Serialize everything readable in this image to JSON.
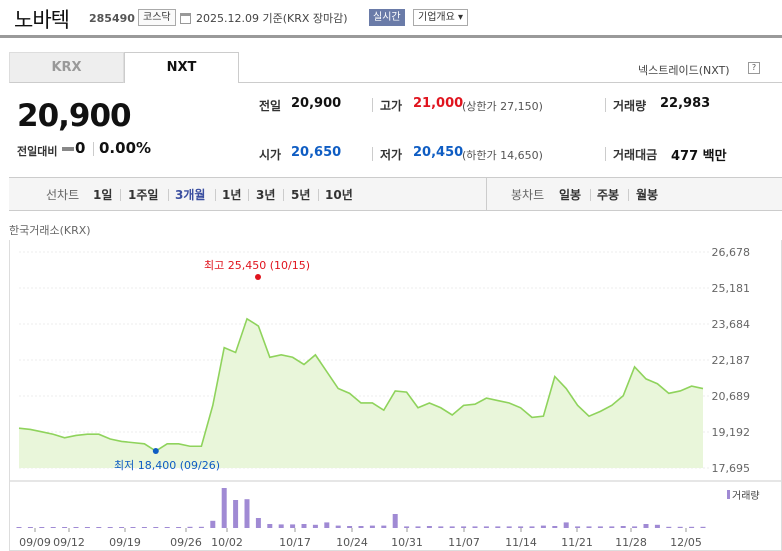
{
  "header": {
    "name": "노바텍",
    "code": "285490",
    "market": "코스닥",
    "as_of": "2025.12.09 기준(KRX 장마감)",
    "realtime": "실시간",
    "company_info": "기업개요 ▾"
  },
  "tabs": [
    {
      "label": "KRX",
      "active": false
    },
    {
      "label": "NXT",
      "active": true
    }
  ],
  "nxt_link": "넥스트레이드(NXT)",
  "nxt_link_icon": "?",
  "quote": {
    "price": "20,900",
    "change_label": "전일대비",
    "change_value": "0",
    "change_pct": "0.00%",
    "prev_close_label": "전일",
    "prev_close": "20,900",
    "high_label": "고가",
    "high": "21,000",
    "upper_limit": "(상한가 27,150)",
    "volume_label": "거래량",
    "volume": "22,983",
    "open_label": "시가",
    "open": "20,650",
    "low_label": "저가",
    "low": "20,450",
    "lower_limit": "(하한가 14,650)",
    "trade_value_label": "거래대금",
    "trade_value": "477 백만"
  },
  "periods": {
    "line_label": "선차트",
    "line_items": [
      "1일",
      "1주일",
      "3개월",
      "1년",
      "3년",
      "5년",
      "10년"
    ],
    "active": "3개월",
    "candle_label": "봉차트",
    "candle_items": [
      "일봉",
      "주봉",
      "월봉"
    ]
  },
  "exchange_label": "한국거래소(KRX)",
  "colors": {
    "accent": "#3b4fa0",
    "up": "#e0141e",
    "down": "#0f5dc3",
    "line": "#8fd35c",
    "fill": "#e9f6da",
    "volume": "#a08ad4"
  },
  "chart_data": {
    "type": "area",
    "ylim": [
      17695,
      26678
    ],
    "yticks": [
      "26,678",
      "25,181",
      "23,684",
      "22,187",
      "20,689",
      "19,192",
      "17,695"
    ],
    "xticks": [
      "09/09",
      "09/12",
      "09/19",
      "09/26",
      "10/02",
      "10/17",
      "10/24",
      "10/31",
      "11/07",
      "11/14",
      "11/21",
      "11/28",
      "12/05"
    ],
    "max_annotation": "최고 25,450 (10/15)",
    "min_annotation": "최저 18,400 (09/26)",
    "volume_legend": "거래량",
    "grid": true,
    "prices": [
      19350,
      19300,
      19200,
      19100,
      18950,
      19050,
      19100,
      19100,
      18900,
      18800,
      18750,
      18700,
      18400,
      18700,
      18700,
      18600,
      18600,
      20300,
      22700,
      22500,
      23900,
      23600,
      22300,
      22400,
      22300,
      22000,
      22400,
      21700,
      21000,
      20800,
      20400,
      20400,
      20100,
      20900,
      20850,
      20200,
      20400,
      20200,
      19900,
      20300,
      20350,
      20600,
      20500,
      20400,
      20200,
      19800,
      19850,
      21500,
      21000,
      20300,
      19850,
      20050,
      20300,
      20700,
      21900,
      21400,
      21200,
      20800,
      20900,
      21100,
      21000
    ],
    "volume": [
      2,
      2,
      2,
      2,
      2,
      2,
      2,
      2,
      2,
      2,
      2,
      2,
      2,
      2,
      2,
      3,
      3,
      18,
      100,
      70,
      72,
      25,
      10,
      9,
      9,
      10,
      8,
      14,
      6,
      5,
      5,
      6,
      6,
      35,
      4,
      4,
      5,
      4,
      4,
      4,
      4,
      4,
      4,
      4,
      4,
      4,
      6,
      5,
      14,
      4,
      4,
      4,
      4,
      5,
      4,
      10,
      8,
      3,
      3,
      3,
      3
    ]
  }
}
